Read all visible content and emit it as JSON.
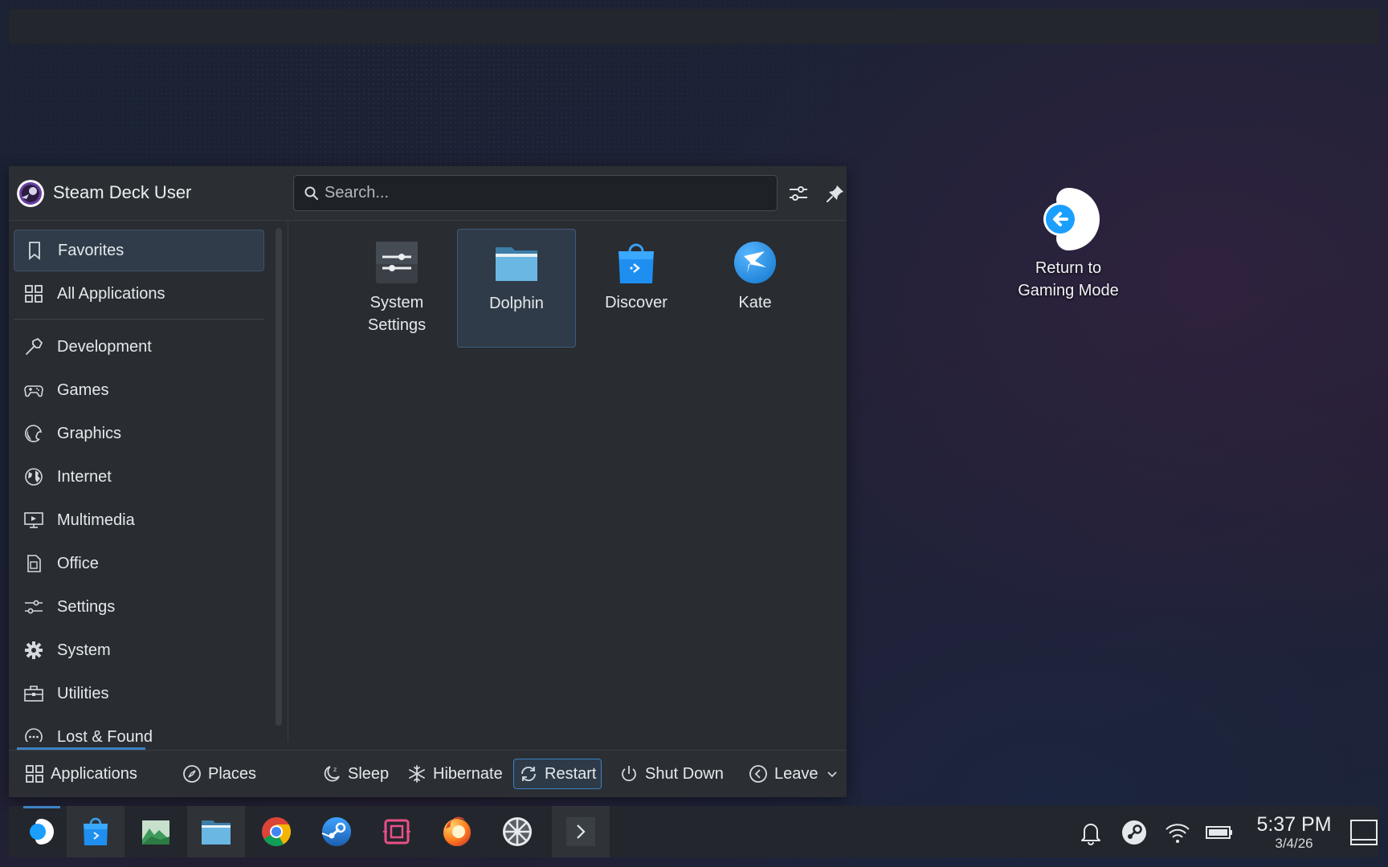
{
  "desktop": {
    "return_icon_label": "Return to Gaming Mode"
  },
  "launcher": {
    "user_name": "Steam Deck User",
    "search_placeholder": "Search...",
    "sidebar": {
      "items": [
        {
          "label": "Favorites",
          "icon": "bookmark-icon",
          "active": true
        },
        {
          "label": "All Applications",
          "icon": "grid-icon"
        },
        {
          "label": "Development",
          "icon": "hammer-icon"
        },
        {
          "label": "Games",
          "icon": "gamepad-icon"
        },
        {
          "label": "Graphics",
          "icon": "palette-icon"
        },
        {
          "label": "Internet",
          "icon": "globe-icon"
        },
        {
          "label": "Multimedia",
          "icon": "monitor-play-icon"
        },
        {
          "label": "Office",
          "icon": "document-icon"
        },
        {
          "label": "Settings",
          "icon": "sliders-icon"
        },
        {
          "label": "System",
          "icon": "gear-icon"
        },
        {
          "label": "Utilities",
          "icon": "toolbox-icon"
        },
        {
          "label": "Lost & Found",
          "icon": "ellipsis-circle-icon"
        }
      ]
    },
    "apps": [
      {
        "label": "System Settings",
        "icon": "system-settings-icon"
      },
      {
        "label": "Dolphin",
        "icon": "folder-icon",
        "selected": true
      },
      {
        "label": "Discover",
        "icon": "shopping-bag-icon"
      },
      {
        "label": "Kate",
        "icon": "kate-bird-icon"
      }
    ],
    "footer": {
      "applications": "Applications",
      "places": "Places",
      "sleep": "Sleep",
      "hibernate": "Hibernate",
      "restart": "Restart",
      "shutdown": "Shut Down",
      "leave": "Leave"
    }
  },
  "taskbar": {
    "apps": [
      {
        "name": "Application Launcher",
        "icon": "steamdeck-launcher-icon"
      },
      {
        "name": "Discover",
        "icon": "shopping-bag-icon"
      },
      {
        "name": "Gwenview",
        "icon": "image-viewer-icon"
      },
      {
        "name": "Dolphin",
        "icon": "folder-icon"
      },
      {
        "name": "Google Chrome",
        "icon": "chrome-icon"
      },
      {
        "name": "Steam",
        "icon": "steam-icon"
      },
      {
        "name": "Screen Capture",
        "icon": "capture-icon"
      },
      {
        "name": "Firefox",
        "icon": "firefox-icon"
      },
      {
        "name": "Kiosk",
        "icon": "aperture-icon"
      },
      {
        "name": "Konsole",
        "icon": "terminal-icon"
      }
    ],
    "clock": {
      "time": "5:37 PM",
      "date": "3/4/26"
    }
  },
  "colors": {
    "accent": "#3d82c4",
    "panel": "#23272d",
    "launcher_bg": "#292c31"
  }
}
